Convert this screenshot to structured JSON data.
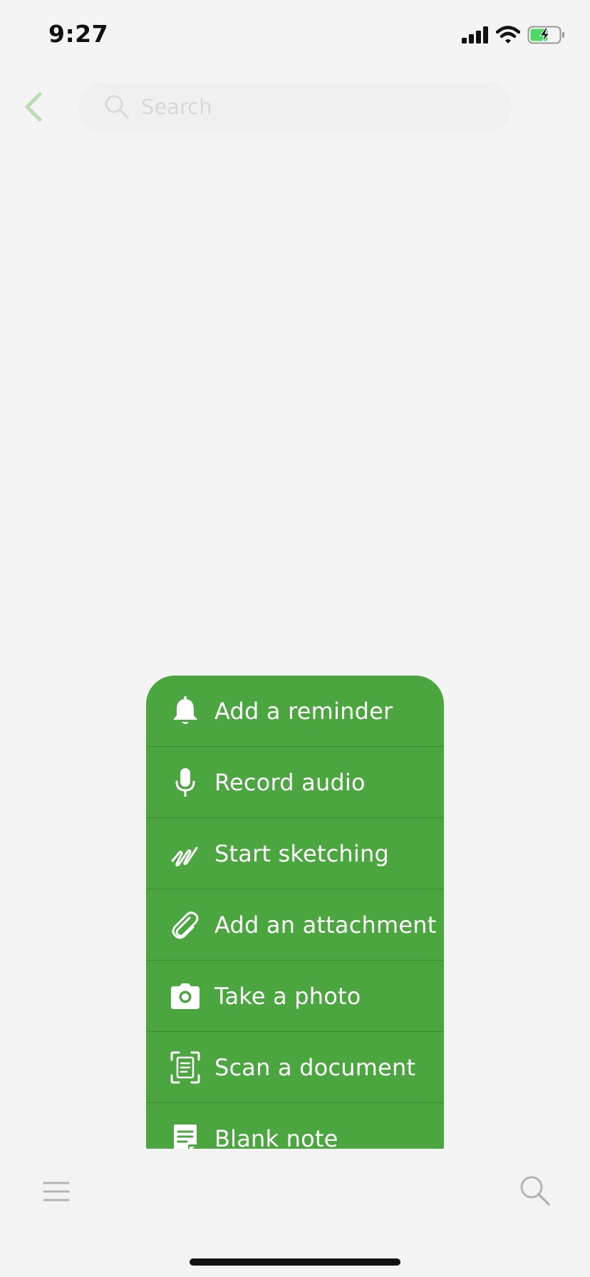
{
  "status_bar": {
    "time": "9:27",
    "icons": [
      "signal-icon",
      "wifi-icon",
      "battery-charging-icon"
    ]
  },
  "header": {
    "back_icon": "chevron-left-icon",
    "search": {
      "placeholder": "Search",
      "value": ""
    }
  },
  "action_menu": {
    "items": [
      {
        "label": "Add a reminder",
        "icon": "bell-icon"
      },
      {
        "label": "Record audio",
        "icon": "microphone-icon"
      },
      {
        "label": "Start sketching",
        "icon": "sketch-icon"
      },
      {
        "label": "Add an attachment",
        "icon": "paperclip-icon"
      },
      {
        "label": "Take a photo",
        "icon": "camera-icon"
      },
      {
        "label": "Scan a document",
        "icon": "scan-document-icon"
      },
      {
        "label": "Blank note",
        "icon": "note-icon"
      }
    ]
  },
  "bottom_bar": {
    "left_icon": "hamburger-menu-icon",
    "right_icon": "search-icon"
  },
  "colors": {
    "accent_green": "#4ca640",
    "divider_green": "#3a8c32",
    "background": "#f4f4f4",
    "back_chevron": "#b9dcb4",
    "battery_fill": "#4cd964"
  }
}
